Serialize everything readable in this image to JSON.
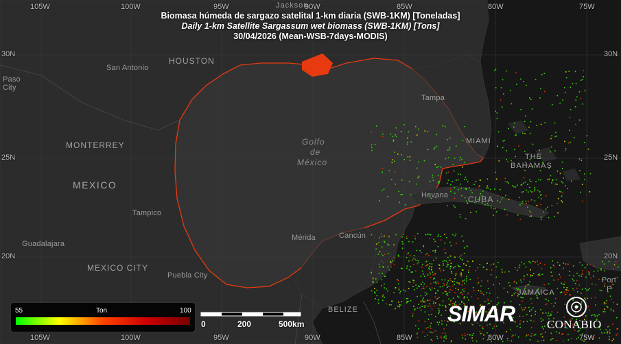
{
  "title": {
    "line1": "Biomasa húmeda de sargazo satelital 1-km diaria (SWB-1KM) [Toneladas]",
    "line2": "Daily 1-km Satellite Sargassum wet biomass (SWB-1KM) [Tons]",
    "line3": "30/04/2026 (Mean-WSB-7days-MODIS)"
  },
  "axes": {
    "lon_top": [
      "105W",
      "100W",
      "95W",
      "90W",
      "85W",
      "80W",
      "75W"
    ],
    "lon_bottom": [
      "105W",
      "100W",
      "95W",
      "90W",
      "85W",
      "80W",
      "75W"
    ],
    "lat_left": [
      "30N",
      "25N",
      "20N"
    ],
    "lat_right": [
      "30N",
      "25N",
      "20N"
    ]
  },
  "places": {
    "jacksonville": "Jackson",
    "houston": "HOUSTON",
    "san_antonio": "San Antonio",
    "tampa": "Tampa",
    "miami": "MIAMI",
    "the": "THE",
    "bahamas": "BAHAMAS",
    "golfo": "Golfo",
    "de": "de",
    "mexico_sea": "México",
    "monterrey": "MONTERREY",
    "mexico": "MEXICO",
    "tampico": "Tampico",
    "guadalajara": "Guadalajara",
    "mexico_city": "MEXICO CITY",
    "puebla": "Puebla City",
    "merida": "Mérida",
    "cancun": "Cancún",
    "havana": "Havana",
    "cuba": "CUBA",
    "jamaica": "JAMAICA",
    "belize": "BELIZE",
    "port_a": "Port",
    "port_b": "P",
    "el_paso_a": "Paso",
    "el_paso_b": "City"
  },
  "legend": {
    "min": "55",
    "unit": "Ton",
    "max": "100",
    "colors": [
      "#00ff00",
      "#ffff00",
      "#ff4400",
      "#cc0000",
      "#7a0000"
    ]
  },
  "scalebar": {
    "labels": [
      "0",
      "200",
      "500km"
    ]
  },
  "logos": {
    "simar": "SIMAR",
    "conabio": "CONABIO"
  },
  "colors": {
    "land": "#2c2c2c",
    "ocean": "#1a1a1a",
    "gulf": "#333333",
    "coast_highlight": "#e83a10",
    "sargassum_low": "#33dd00",
    "sargassum_mid": "#ddcc00",
    "sargassum_high": "#dd3300"
  }
}
